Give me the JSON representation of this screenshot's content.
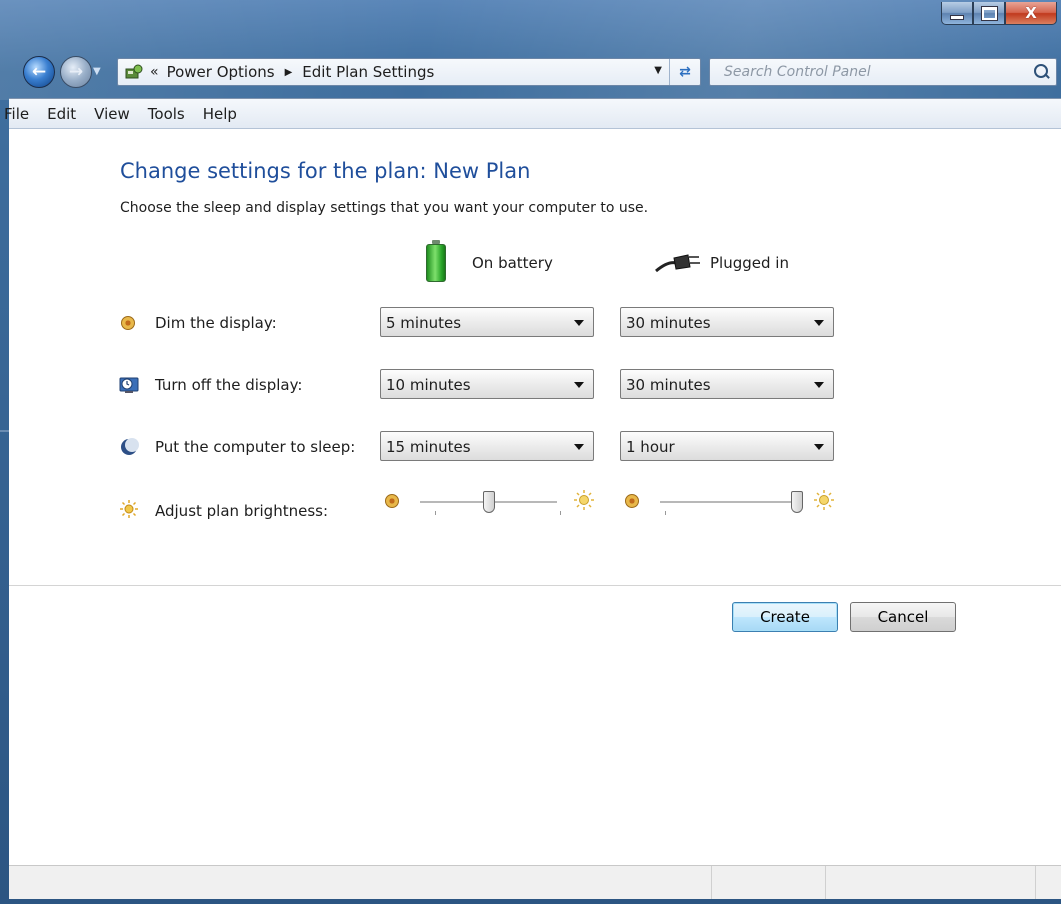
{
  "window": {
    "controls": {
      "minimize": "minimize",
      "maximize": "maximize",
      "close": "X"
    }
  },
  "address": {
    "overflow": "«",
    "breadcrumbs": [
      "Power Options",
      "Edit Plan Settings"
    ],
    "search_placeholder": "Search Control Panel"
  },
  "menu": [
    "File",
    "Edit",
    "View",
    "Tools",
    "Help"
  ],
  "main": {
    "title": "Change settings for the plan: New Plan",
    "subtitle": "Choose the sleep and display settings that you want your computer to use.",
    "columns": {
      "battery": "On battery",
      "plugged": "Plugged in"
    },
    "rows": [
      {
        "label": "Dim the display:",
        "battery": "5 minutes",
        "plugged": "30 minutes",
        "icon": "dim-icon"
      },
      {
        "label": "Turn off the display:",
        "battery": "10 minutes",
        "plugged": "30 minutes",
        "icon": "display-off-icon"
      },
      {
        "label": "Put the computer to sleep:",
        "battery": "15 minutes",
        "plugged": "1 hour",
        "icon": "sleep-icon"
      }
    ],
    "brightness": {
      "label": "Adjust plan brightness:",
      "battery_level": 0.5,
      "plugged_level": 1.0
    }
  },
  "buttons": {
    "create": "Create",
    "cancel": "Cancel"
  },
  "colors": {
    "heading": "#1f4e9b",
    "frame": "#34608f",
    "accent": "#3c7fb1"
  }
}
